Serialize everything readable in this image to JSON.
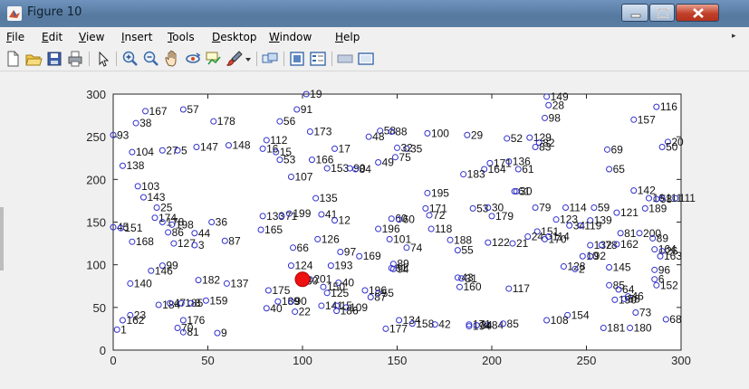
{
  "window": {
    "title": "Figure 10",
    "controls": {
      "minimize": "minimize",
      "maximize": "maximize",
      "close": "close"
    }
  },
  "menu": {
    "items": [
      {
        "label": "File",
        "mnemonic": "F",
        "rest": "ile"
      },
      {
        "label": "Edit",
        "mnemonic": "E",
        "rest": "dit"
      },
      {
        "label": "View",
        "mnemonic": "V",
        "rest": "iew"
      },
      {
        "label": "Insert",
        "mnemonic": "I",
        "rest": "nsert"
      },
      {
        "label": "Tools",
        "mnemonic": "T",
        "rest": "ools"
      },
      {
        "label": "Desktop",
        "mnemonic": "D",
        "rest": "esktop"
      },
      {
        "label": "Window",
        "mnemonic": "W",
        "rest": "indow"
      },
      {
        "label": "Help",
        "mnemonic": "H",
        "rest": "elp"
      }
    ],
    "overflow_icon": "chevron-right-icon"
  },
  "toolbar": {
    "buttons": [
      "new-figure-icon",
      "open-file-icon",
      "save-icon",
      "print-icon",
      "pointer-icon",
      "zoom-in-icon",
      "zoom-out-icon",
      "pan-icon",
      "rotate-icon",
      "data-cursor-icon",
      "brush-icon",
      "dropdown-arrow-icon",
      "link-plot-icon",
      "colorbar-icon",
      "legend-icon",
      "hide-plot-tools-icon",
      "show-plot-tools-icon"
    ]
  },
  "chart_data": {
    "type": "scatter",
    "title": "",
    "xlabel": "",
    "ylabel": "",
    "xlim": [
      0,
      300
    ],
    "ylim": [
      0,
      300
    ],
    "xticks": [
      0,
      50,
      100,
      150,
      200,
      250,
      300
    ],
    "yticks": [
      0,
      50,
      100,
      150,
      200,
      250,
      300
    ],
    "grid": false,
    "marker_color": "#3030cc",
    "highlight_color": "#ee1111",
    "highlight_point": {
      "x": 100,
      "y": 83
    },
    "points": [
      {
        "x": 102,
        "y": 300,
        "label": "19"
      },
      {
        "x": 229,
        "y": 297,
        "label": "149"
      },
      {
        "x": 230,
        "y": 287,
        "label": "28"
      },
      {
        "x": 287,
        "y": 285,
        "label": "116"
      },
      {
        "x": 17,
        "y": 280,
        "label": "167"
      },
      {
        "x": 37,
        "y": 282,
        "label": "57"
      },
      {
        "x": 97,
        "y": 282,
        "label": "91"
      },
      {
        "x": 228,
        "y": 272,
        "label": "98"
      },
      {
        "x": 275,
        "y": 270,
        "label": "157"
      },
      {
        "x": 12,
        "y": 266,
        "label": "38"
      },
      {
        "x": 53,
        "y": 268,
        "label": "178"
      },
      {
        "x": 88,
        "y": 268,
        "label": "56"
      },
      {
        "x": 0,
        "y": 252,
        "label": "93"
      },
      {
        "x": 104,
        "y": 256,
        "label": "173"
      },
      {
        "x": 141,
        "y": 257,
        "label": "58"
      },
      {
        "x": 147,
        "y": 256,
        "label": "88"
      },
      {
        "x": 166,
        "y": 254,
        "label": "100"
      },
      {
        "x": 187,
        "y": 252,
        "label": "29"
      },
      {
        "x": 208,
        "y": 248,
        "label": "52"
      },
      {
        "x": 220,
        "y": 249,
        "label": "129"
      },
      {
        "x": 81,
        "y": 246,
        "label": "112"
      },
      {
        "x": 135,
        "y": 250,
        "label": "48"
      },
      {
        "x": 225,
        "y": 243,
        "label": "82"
      },
      {
        "x": 293,
        "y": 244,
        "label": "20"
      },
      {
        "x": 44,
        "y": 238,
        "label": "147"
      },
      {
        "x": 61,
        "y": 240,
        "label": "148"
      },
      {
        "x": 79,
        "y": 236,
        "label": "16"
      },
      {
        "x": 155,
        "y": 236,
        "label": "35"
      },
      {
        "x": 223,
        "y": 238,
        "label": "83"
      },
      {
        "x": 290,
        "y": 238,
        "label": "50"
      },
      {
        "x": 10,
        "y": 232,
        "label": "104"
      },
      {
        "x": 26,
        "y": 234,
        "label": "27"
      },
      {
        "x": 34,
        "y": 234,
        "label": "5"
      },
      {
        "x": 86,
        "y": 232,
        "label": "15"
      },
      {
        "x": 117,
        "y": 236,
        "label": "17"
      },
      {
        "x": 150,
        "y": 237,
        "label": "32"
      },
      {
        "x": 149,
        "y": 226,
        "label": "75"
      },
      {
        "x": 261,
        "y": 235,
        "label": "69"
      },
      {
        "x": 88,
        "y": 223,
        "label": "53"
      },
      {
        "x": 105,
        "y": 223,
        "label": "166"
      },
      {
        "x": 140,
        "y": 220,
        "label": "49"
      },
      {
        "x": 199,
        "y": 219,
        "label": "171"
      },
      {
        "x": 209,
        "y": 221,
        "label": "136"
      },
      {
        "x": 5,
        "y": 216,
        "label": "138"
      },
      {
        "x": 113,
        "y": 213,
        "label": "153"
      },
      {
        "x": 125,
        "y": 213,
        "label": "90"
      },
      {
        "x": 128,
        "y": 212,
        "label": "84"
      },
      {
        "x": 196,
        "y": 212,
        "label": "164"
      },
      {
        "x": 214,
        "y": 212,
        "label": "61"
      },
      {
        "x": 185,
        "y": 206,
        "label": "183"
      },
      {
        "x": 262,
        "y": 212,
        "label": "65"
      },
      {
        "x": 94,
        "y": 203,
        "label": "107"
      },
      {
        "x": 13,
        "y": 192,
        "label": "103"
      },
      {
        "x": 275,
        "y": 187,
        "label": "142"
      },
      {
        "x": 212,
        "y": 186,
        "label": "61"
      },
      {
        "x": 213,
        "y": 186,
        "label": "30"
      },
      {
        "x": 166,
        "y": 184,
        "label": "195"
      },
      {
        "x": 16,
        "y": 179,
        "label": "143"
      },
      {
        "x": 107,
        "y": 178,
        "label": "135"
      },
      {
        "x": 283,
        "y": 178,
        "label": "16"
      },
      {
        "x": 287,
        "y": 177,
        "label": "58"
      },
      {
        "x": 290,
        "y": 178,
        "label": "111"
      },
      {
        "x": 297,
        "y": 178,
        "label": "111"
      },
      {
        "x": 23,
        "y": 167,
        "label": "25"
      },
      {
        "x": 165,
        "y": 166,
        "label": "171"
      },
      {
        "x": 190,
        "y": 166,
        "label": "53"
      },
      {
        "x": 198,
        "y": 167,
        "label": "30"
      },
      {
        "x": 223,
        "y": 167,
        "label": "79"
      },
      {
        "x": 239,
        "y": 167,
        "label": "114"
      },
      {
        "x": 254,
        "y": 167,
        "label": "59"
      },
      {
        "x": 281,
        "y": 166,
        "label": "189"
      },
      {
        "x": 93,
        "y": 160,
        "label": "199"
      },
      {
        "x": 110,
        "y": 159,
        "label": "41"
      },
      {
        "x": 167,
        "y": 158,
        "label": "72"
      },
      {
        "x": 200,
        "y": 157,
        "label": "179"
      },
      {
        "x": 266,
        "y": 161,
        "label": "121"
      },
      {
        "x": 22,
        "y": 155,
        "label": "174"
      },
      {
        "x": 79,
        "y": 157,
        "label": "133"
      },
      {
        "x": 89,
        "y": 157,
        "label": "71"
      },
      {
        "x": 117,
        "y": 152,
        "label": "12"
      },
      {
        "x": 147,
        "y": 154,
        "label": "60"
      },
      {
        "x": 151,
        "y": 153,
        "label": "60"
      },
      {
        "x": 234,
        "y": 153,
        "label": "123"
      },
      {
        "x": 252,
        "y": 152,
        "label": "139"
      },
      {
        "x": 26,
        "y": 150,
        "label": "178"
      },
      {
        "x": 31,
        "y": 147,
        "label": "198"
      },
      {
        "x": 52,
        "y": 150,
        "label": "36"
      },
      {
        "x": 241,
        "y": 146,
        "label": "34"
      },
      {
        "x": 247,
        "y": 146,
        "label": "119"
      },
      {
        "x": 0,
        "y": 144,
        "label": "45"
      },
      {
        "x": 4,
        "y": 143,
        "label": "151"
      },
      {
        "x": 224,
        "y": 139,
        "label": "151"
      },
      {
        "x": 29,
        "y": 138,
        "label": "86"
      },
      {
        "x": 43,
        "y": 137,
        "label": "44"
      },
      {
        "x": 78,
        "y": 141,
        "label": "165"
      },
      {
        "x": 140,
        "y": 142,
        "label": "196"
      },
      {
        "x": 168,
        "y": 142,
        "label": "118"
      },
      {
        "x": 219,
        "y": 133,
        "label": "24"
      },
      {
        "x": 230,
        "y": 133,
        "label": "114"
      },
      {
        "x": 268,
        "y": 137,
        "label": "81"
      },
      {
        "x": 278,
        "y": 137,
        "label": "200"
      },
      {
        "x": 285,
        "y": 131,
        "label": "89"
      },
      {
        "x": 108,
        "y": 130,
        "label": "126"
      },
      {
        "x": 146,
        "y": 130,
        "label": "101"
      },
      {
        "x": 178,
        "y": 129,
        "label": "188"
      },
      {
        "x": 198,
        "y": 126,
        "label": "122"
      },
      {
        "x": 211,
        "y": 125,
        "label": "21"
      },
      {
        "x": 228,
        "y": 130,
        "label": "170"
      },
      {
        "x": 10,
        "y": 127,
        "label": "168"
      },
      {
        "x": 32,
        "y": 125,
        "label": "127"
      },
      {
        "x": 43,
        "y": 123,
        "label": "3"
      },
      {
        "x": 59,
        "y": 128,
        "label": "87"
      },
      {
        "x": 252,
        "y": 123,
        "label": "132"
      },
      {
        "x": 258,
        "y": 123,
        "label": "78"
      },
      {
        "x": 266,
        "y": 124,
        "label": "162"
      },
      {
        "x": 286,
        "y": 118,
        "label": "164"
      },
      {
        "x": 290,
        "y": 116,
        "label": "26"
      },
      {
        "x": 95,
        "y": 120,
        "label": "66"
      },
      {
        "x": 155,
        "y": 120,
        "label": "74"
      },
      {
        "x": 182,
        "y": 117,
        "label": "55"
      },
      {
        "x": 289,
        "y": 110,
        "label": "163"
      },
      {
        "x": 120,
        "y": 115,
        "label": "97"
      },
      {
        "x": 130,
        "y": 110,
        "label": "169"
      },
      {
        "x": 248,
        "y": 110,
        "label": "10"
      },
      {
        "x": 252,
        "y": 110,
        "label": "92"
      },
      {
        "x": 148,
        "y": 101,
        "label": "89"
      },
      {
        "x": 147,
        "y": 96,
        "label": "61"
      },
      {
        "x": 148,
        "y": 95,
        "label": "94"
      },
      {
        "x": 26,
        "y": 99,
        "label": "99"
      },
      {
        "x": 94,
        "y": 99,
        "label": "124"
      },
      {
        "x": 115,
        "y": 99,
        "label": "193"
      },
      {
        "x": 238,
        "y": 98,
        "label": "128"
      },
      {
        "x": 262,
        "y": 97,
        "label": "145"
      },
      {
        "x": 286,
        "y": 94,
        "label": "96"
      },
      {
        "x": 244,
        "y": 95,
        "label": "2"
      },
      {
        "x": 20,
        "y": 93,
        "label": "146"
      },
      {
        "x": 182,
        "y": 85,
        "label": "43"
      },
      {
        "x": 184,
        "y": 84,
        "label": "31"
      },
      {
        "x": 286,
        "y": 83,
        "label": "6"
      },
      {
        "x": 45,
        "y": 82,
        "label": "182"
      },
      {
        "x": 104,
        "y": 83,
        "label": "201"
      },
      {
        "x": 60,
        "y": 78,
        "label": "137"
      },
      {
        "x": 119,
        "y": 79,
        "label": "40"
      },
      {
        "x": 100,
        "y": 81,
        "label": "30"
      },
      {
        "x": 9,
        "y": 78,
        "label": "140"
      },
      {
        "x": 262,
        "y": 76,
        "label": "85"
      },
      {
        "x": 287,
        "y": 76,
        "label": "152"
      },
      {
        "x": 183,
        "y": 74,
        "label": "160"
      },
      {
        "x": 111,
        "y": 74,
        "label": "150"
      },
      {
        "x": 209,
        "y": 72,
        "label": "117"
      },
      {
        "x": 82,
        "y": 70,
        "label": "175"
      },
      {
        "x": 113,
        "y": 67,
        "label": "125"
      },
      {
        "x": 133,
        "y": 70,
        "label": "196"
      },
      {
        "x": 140,
        "y": 67,
        "label": "55"
      },
      {
        "x": 267,
        "y": 71,
        "label": "64"
      },
      {
        "x": 272,
        "y": 63,
        "label": "46"
      },
      {
        "x": 136,
        "y": 62,
        "label": "87"
      },
      {
        "x": 265,
        "y": 59,
        "label": "190"
      },
      {
        "x": 270,
        "y": 60,
        "label": "58"
      },
      {
        "x": 49,
        "y": 58,
        "label": "159"
      },
      {
        "x": 24,
        "y": 53,
        "label": "184"
      },
      {
        "x": 30,
        "y": 55,
        "label": "47"
      },
      {
        "x": 36,
        "y": 55,
        "label": "185"
      },
      {
        "x": 41,
        "y": 55,
        "label": "8"
      },
      {
        "x": 87,
        "y": 57,
        "label": "189"
      },
      {
        "x": 94,
        "y": 57,
        "label": "90"
      },
      {
        "x": 110,
        "y": 52,
        "label": "141"
      },
      {
        "x": 118,
        "y": 52,
        "label": "15"
      },
      {
        "x": 123,
        "y": 50,
        "label": "109"
      },
      {
        "x": 81,
        "y": 49,
        "label": "40"
      },
      {
        "x": 96,
        "y": 45,
        "label": "22"
      },
      {
        "x": 118,
        "y": 46,
        "label": "186"
      },
      {
        "x": 276,
        "y": 44,
        "label": "73"
      },
      {
        "x": 292,
        "y": 36,
        "label": "68"
      },
      {
        "x": 240,
        "y": 41,
        "label": "154"
      },
      {
        "x": 229,
        "y": 35,
        "label": "108"
      },
      {
        "x": 9,
        "y": 41,
        "label": "23"
      },
      {
        "x": 5,
        "y": 35,
        "label": "162"
      },
      {
        "x": 37,
        "y": 35,
        "label": "176"
      },
      {
        "x": 151,
        "y": 35,
        "label": "134"
      },
      {
        "x": 158,
        "y": 31,
        "label": "158"
      },
      {
        "x": 170,
        "y": 30,
        "label": "42"
      },
      {
        "x": 188,
        "y": 30,
        "label": "171"
      },
      {
        "x": 198,
        "y": 29,
        "label": "84"
      },
      {
        "x": 206,
        "y": 31,
        "label": "85"
      },
      {
        "x": 188,
        "y": 28,
        "label": "194"
      },
      {
        "x": 192,
        "y": 29,
        "label": "34"
      },
      {
        "x": 34,
        "y": 26,
        "label": "70"
      },
      {
        "x": 37,
        "y": 21,
        "label": "81"
      },
      {
        "x": 55,
        "y": 20,
        "label": "9"
      },
      {
        "x": 144,
        "y": 25,
        "label": "177"
      },
      {
        "x": 259,
        "y": 26,
        "label": "181"
      },
      {
        "x": 273,
        "y": 26,
        "label": "180"
      },
      {
        "x": 2,
        "y": 24,
        "label": "1"
      }
    ]
  }
}
